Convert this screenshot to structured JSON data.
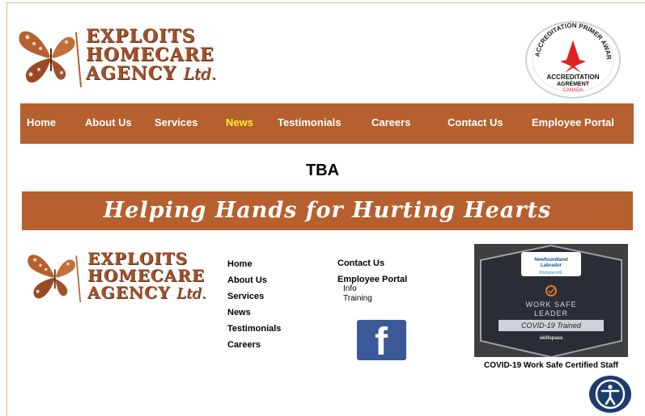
{
  "logo": {
    "line1": "EXPLOITS",
    "line2": "HOMECARE",
    "line3": "AGENCY",
    "suffix": "Ltd."
  },
  "award": {
    "ring_text": "ACCREDITATION PRIMER AWARD",
    "line1": "ACCREDITATION",
    "line2": "AGRÉMENT",
    "line3": "CANADA"
  },
  "nav": {
    "items": [
      {
        "label": "Home"
      },
      {
        "label": "About Us"
      },
      {
        "label": "Services"
      },
      {
        "label": "News"
      },
      {
        "label": "Testimonials"
      },
      {
        "label": "Careers"
      },
      {
        "label": "Contact Us"
      },
      {
        "label": "Employee Portal"
      }
    ],
    "active_color": "#ffee33"
  },
  "main": {
    "heading": "TBA",
    "banner": "Helping Hands for Hurting Hearts"
  },
  "footer": {
    "col1": [
      "Home",
      "About Us",
      "Services",
      "News",
      "Testimonials",
      "Careers"
    ],
    "col2": {
      "contact": "Contact Us",
      "portal": "Employee Portal",
      "sub": [
        "Info",
        "Training"
      ]
    },
    "facebook": "f",
    "covid_card": {
      "org1": "Newfoundland",
      "org2": "Labrador",
      "brand": "WorkplaceNL",
      "line1": "WORK SAFE",
      "line2": "LEADER",
      "line3": "COVID-19 Trained",
      "footer_brand": "skillspass"
    },
    "covid_caption": "COVID-19 Work Safe Certified Staff"
  },
  "colors": {
    "brand_brown": "#b5602e",
    "facebook_blue": "#3b5998",
    "accessibility_navy": "#1c3c6e"
  }
}
